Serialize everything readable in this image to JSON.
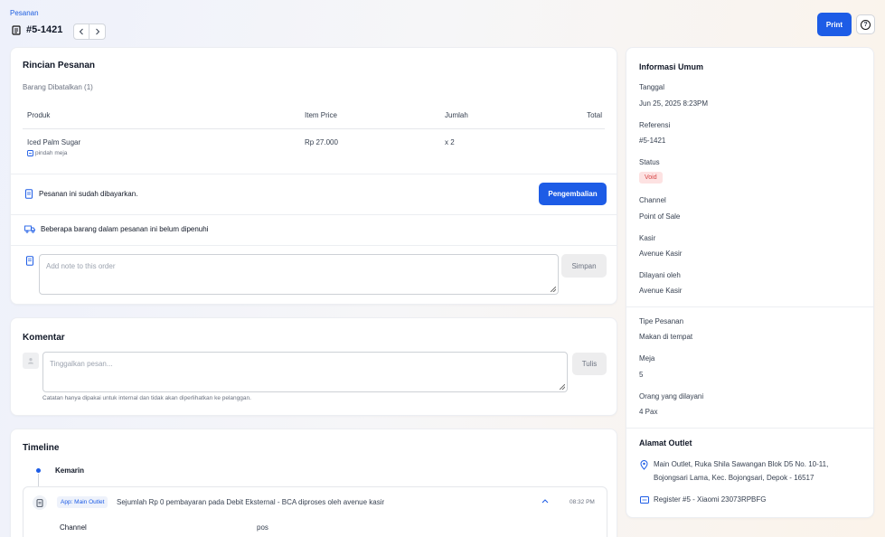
{
  "header": {
    "breadcrumb": "Pesanan",
    "order_id": "#5-1421",
    "print_label": "Print",
    "help_symbol": "?"
  },
  "order_details": {
    "title": "Rincian Pesanan",
    "cancelled_label": "Barang Dibatalkan (1)",
    "columns": [
      "Produk",
      "Item Price",
      "Jumlah",
      "Total"
    ],
    "items": [
      {
        "product": "Iced Palm Sugar",
        "note": "pindah meja",
        "price": "Rp 27.000",
        "qty": "x 2",
        "total": ""
      }
    ],
    "paid_message": "Pesanan ini sudah dibayarkan.",
    "refund_label": "Pengembalian",
    "unfulfilled_message": "Beberapa barang dalam pesanan ini belum dipenuhi",
    "note_placeholder": "Add note to this order",
    "save_label": "Simpan"
  },
  "comments": {
    "title": "Komentar",
    "placeholder": "Tinggalkan pesan...",
    "submit_label": "Tulis",
    "hint": "Catatan hanya dipakai untuk internal dan tidak akan diperlihatkan ke pelanggan."
  },
  "timeline": {
    "title": "Timeline",
    "day_label": "Kemarin",
    "entry": {
      "tag": "App: Main Outlet",
      "text": "Sejumlah Rp 0 pembayaran pada Debit Eksternal - BCA diproses oleh avenue kasir",
      "time": "08:32 PM",
      "detail_key": "Channel",
      "detail_value": "pos"
    }
  },
  "general_info": {
    "title": "Informasi Umum",
    "fields": [
      {
        "label": "Tanggal",
        "value": "Jun 25, 2025 8:23PM"
      },
      {
        "label": "Referensi",
        "value": "#5-1421"
      },
      {
        "label": "Status",
        "value": "Void"
      },
      {
        "label": "Channel",
        "value": "Point of Sale"
      },
      {
        "label": "Kasir",
        "value": "Avenue Kasir"
      },
      {
        "label": "Dilayani oleh",
        "value": "Avenue Kasir"
      }
    ],
    "fields2": [
      {
        "label": "Tipe Pesanan",
        "value": "Makan di tempat"
      },
      {
        "label": "Meja",
        "value": "5"
      },
      {
        "label": "Orang yang dilayani",
        "value": "4 Pax"
      }
    ]
  },
  "outlet": {
    "title": "Alamat Outlet",
    "address_line1": "Main Outlet, Ruka Shila Sawangan Blok D5 No. 10-11,",
    "address_line2": "Bojongsari Lama, Kec. Bojongsari, Depok - 16517",
    "register": "Register #5 - Xiaomi 23073RPBFG"
  },
  "colors": {
    "accent": "#1d5ce6",
    "void_bg": "#fde2e2",
    "void_text": "#d64545"
  }
}
